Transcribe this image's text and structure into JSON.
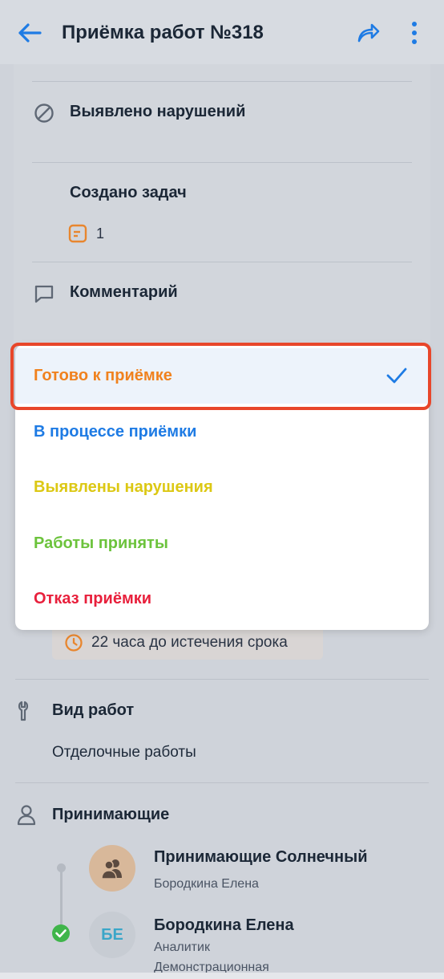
{
  "header": {
    "title": "Приёмка работ №318",
    "back_icon": "arrow-left-icon",
    "share_icon": "share-icon",
    "more_icon": "more-vertical-icon"
  },
  "details": {
    "violations_label": "Выявлено нарушений",
    "tasks_label": "Создано задач",
    "tasks_count": "1",
    "comment_label": "Комментарий"
  },
  "status_dropdown": {
    "options": [
      {
        "label": "Готово к приёмке",
        "color": "#f0821e",
        "selected": true
      },
      {
        "label": "В процессе приёмки",
        "color": "#1e7be4",
        "selected": false
      },
      {
        "label": "Выявлены нарушения",
        "color": "#dcc814",
        "selected": false
      },
      {
        "label": "Работы приняты",
        "color": "#6cc33c",
        "selected": false
      },
      {
        "label": "Отказ приёмки",
        "color": "#e8203c",
        "selected": false
      }
    ]
  },
  "deadline": {
    "text": "22 часа до истечения срока"
  },
  "work_type": {
    "title": "Вид работ",
    "value": "Отделочные работы"
  },
  "receivers": {
    "title": "Принимающие",
    "people": [
      {
        "name": "Принимающие Солнечный",
        "sub1": "Бородкина Елена",
        "sub2": ""
      },
      {
        "name": "Бородкина Елена",
        "initials": "БЕ",
        "sub1": "Аналитик",
        "sub2": "Демонстрационная"
      }
    ]
  },
  "colors": {
    "accent": "#1e7be4",
    "highlight": "#e8462a",
    "task_icon": "#e8862e",
    "check_green": "#3fb54a"
  }
}
